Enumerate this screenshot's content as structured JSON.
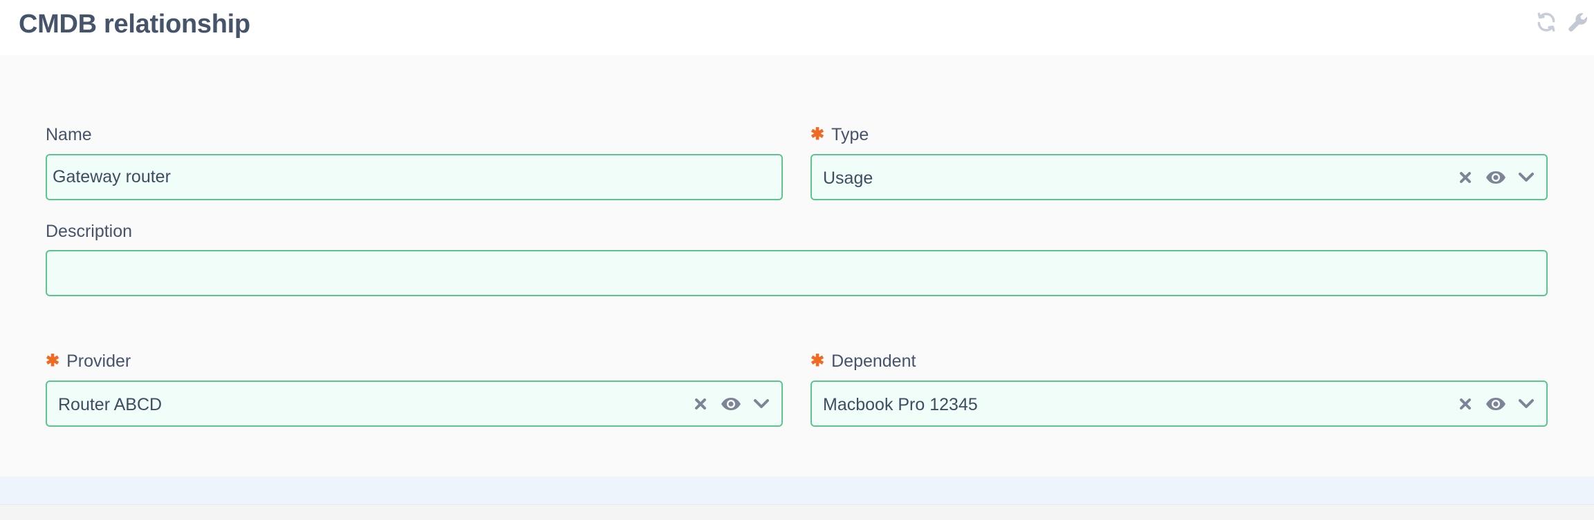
{
  "header": {
    "title": "CMDB relationship",
    "icons": [
      "refresh-icon",
      "wrench-icon"
    ]
  },
  "form": {
    "name": {
      "label": "Name",
      "value": "Gateway router",
      "required": false
    },
    "type": {
      "label": "Type",
      "value": "Usage",
      "required": true
    },
    "description": {
      "label": "Description",
      "value": "",
      "required": false
    },
    "provider": {
      "label": "Provider",
      "value": "Router ABCD",
      "required": true
    },
    "dependent": {
      "label": "Dependent",
      "value": "Macbook Pro 12345",
      "required": true
    },
    "required_marker": "✱"
  },
  "colors": {
    "title": "#45536b",
    "field_border": "#5cc58c",
    "field_bg": "#f0fdf9",
    "required": "#ef6a22",
    "icon": "#7b8596",
    "header_icon": "#c5ccd6"
  }
}
